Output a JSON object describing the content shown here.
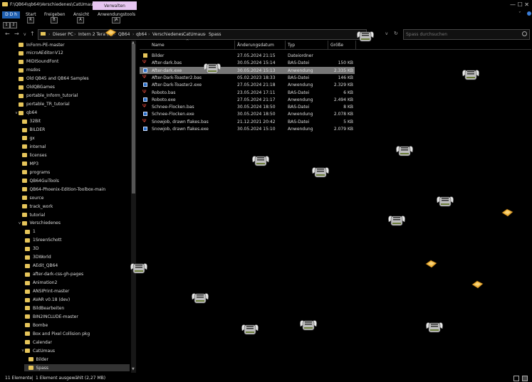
{
  "window": {
    "title": "F:\\QB64\\qb64\\Verschiedenes\\CatUmaus\\S...",
    "context_tab": "Verwalten",
    "controls": "—  ☐  ✕"
  },
  "ribbon": {
    "datei_label": "D D  h",
    "tabs": [
      "Start",
      "Freigeben",
      "Ansicht",
      "Anwendungstools"
    ],
    "keytips": [
      "R",
      "B",
      "A",
      "JA"
    ],
    "quick_access": [
      "1",
      "2"
    ],
    "expand": "ˇ",
    "help": "?"
  },
  "address": {
    "crumbs": [
      "Dieser PC",
      "Intern 2 Tera (F:)",
      "QB64",
      "qb64",
      "Verschiedenes",
      "CatUmaus",
      "Spass"
    ],
    "search_placeholder": "Spass durchsuchen"
  },
  "nav_tree": [
    {
      "label": "InForm-PE-master",
      "indent": 0,
      "arrow": ""
    },
    {
      "label": "microAEditor-V12",
      "indent": 0,
      "arrow": ""
    },
    {
      "label": "MIDISoundFont",
      "indent": 0,
      "arrow": ""
    },
    {
      "label": "msdos",
      "indent": 0,
      "arrow": ""
    },
    {
      "label": "Old QB45 and QB64 Samples",
      "indent": 0,
      "arrow": ""
    },
    {
      "label": "OldQBGames",
      "indent": 0,
      "arrow": ""
    },
    {
      "label": "portable_Inform_tutorial",
      "indent": 0,
      "arrow": ""
    },
    {
      "label": "portable_TR_tutorial",
      "indent": 0,
      "arrow": ""
    },
    {
      "label": "qb64",
      "indent": 0,
      "arrow": "v"
    },
    {
      "label": "32Bit",
      "indent": 1,
      "arrow": ""
    },
    {
      "label": "BILDER",
      "indent": 1,
      "arrow": ""
    },
    {
      "label": "gx",
      "indent": 1,
      "arrow": ""
    },
    {
      "label": "internal",
      "indent": 1,
      "arrow": ""
    },
    {
      "label": "licenses",
      "indent": 1,
      "arrow": ""
    },
    {
      "label": "MP3",
      "indent": 1,
      "arrow": ""
    },
    {
      "label": "programs",
      "indent": 1,
      "arrow": ""
    },
    {
      "label": "QB64GuiTools",
      "indent": 1,
      "arrow": ""
    },
    {
      "label": "QB64-Phoenix-Edition-Toolbox-main",
      "indent": 1,
      "arrow": ""
    },
    {
      "label": "source",
      "indent": 1,
      "arrow": ""
    },
    {
      "label": "track_work",
      "indent": 1,
      "arrow": ""
    },
    {
      "label": "tutorial",
      "indent": 1,
      "arrow": ""
    },
    {
      "label": "Verschiedenes",
      "indent": 1,
      "arrow": "v"
    },
    {
      "label": "1",
      "indent": 2,
      "arrow": ""
    },
    {
      "label": "1SreenSchott",
      "indent": 2,
      "arrow": ""
    },
    {
      "label": "3D",
      "indent": 2,
      "arrow": ""
    },
    {
      "label": "3DWorld",
      "indent": 2,
      "arrow": ""
    },
    {
      "label": "AEdit_QB64",
      "indent": 2,
      "arrow": ""
    },
    {
      "label": "after-dark-css-gh-pages",
      "indent": 2,
      "arrow": ""
    },
    {
      "label": "Animation2",
      "indent": 2,
      "arrow": ""
    },
    {
      "label": "ANSIPrint-master",
      "indent": 2,
      "arrow": ""
    },
    {
      "label": "AVAR v0.18 (dev)",
      "indent": 2,
      "arrow": ""
    },
    {
      "label": "BildBearbeiten",
      "indent": 2,
      "arrow": ""
    },
    {
      "label": "BIN2INCLUDE-master",
      "indent": 2,
      "arrow": ""
    },
    {
      "label": "Bombe",
      "indent": 2,
      "arrow": ""
    },
    {
      "label": "Box and Pixel Collision pkg",
      "indent": 2,
      "arrow": ""
    },
    {
      "label": "Calendar",
      "indent": 2,
      "arrow": ""
    },
    {
      "label": "CatUmaus",
      "indent": 2,
      "arrow": "v"
    },
    {
      "label": "Bilder",
      "indent": 3,
      "arrow": ""
    },
    {
      "label": "Spass",
      "indent": 3,
      "arrow": "",
      "selected": true
    }
  ],
  "columns": [
    "Name",
    "Änderungsdatum",
    "Typ",
    "Größe"
  ],
  "files": [
    {
      "name": "Bilder",
      "date": "27.05.2024 21:15",
      "type": "Dateiordner",
      "size": "",
      "icon": "folder"
    },
    {
      "name": "After-dark.bas",
      "date": "30.05.2024 15:14",
      "type": "BAS-Datei",
      "size": "150 KB",
      "icon": "bas"
    },
    {
      "name": "After-dark.exe",
      "date": "30.05.2024 15:13",
      "type": "Anwendung",
      "size": "2.335 KB",
      "icon": "exe",
      "selected": true
    },
    {
      "name": "After-Dark-Toaster2.bas",
      "date": "05.02.2023 18:33",
      "type": "BAS-Datei",
      "size": "146 KB",
      "icon": "bas"
    },
    {
      "name": "After-Dark-Toaster2.exe",
      "date": "27.05.2024 21:18",
      "type": "Anwendung",
      "size": "2.329 KB",
      "icon": "exe"
    },
    {
      "name": "Roboto.bas",
      "date": "23.05.2024 17:11",
      "type": "BAS-Datei",
      "size": "6 KB",
      "icon": "bas"
    },
    {
      "name": "Roboto.exe",
      "date": "27.05.2024 21:17",
      "type": "Anwendung",
      "size": "2.494 KB",
      "icon": "exe"
    },
    {
      "name": "Schnee-Flocken.bas",
      "date": "30.05.2024 18:50",
      "type": "BAS-Datei",
      "size": "8 KB",
      "icon": "bas"
    },
    {
      "name": "Schnee-Flocken.exe",
      "date": "30.05.2024 18:50",
      "type": "Anwendung",
      "size": "2.078 KB",
      "icon": "exe"
    },
    {
      "name": "Snowjob, drawn flakes.bas",
      "date": "21.12.2021 20:42",
      "type": "BAS-Datei",
      "size": "5 KB",
      "icon": "bas"
    },
    {
      "name": "Snowjob, drawn flakes.exe",
      "date": "30.05.2024 15:10",
      "type": "Anwendung",
      "size": "2.079 KB",
      "icon": "exe"
    }
  ],
  "status": {
    "count": "11 Elemente",
    "selection": "1 Element ausgewählt (2,27 MB)"
  },
  "screensaver": {
    "toaster_color": "#bdbdbd",
    "toast_color": "#f0b43a"
  }
}
